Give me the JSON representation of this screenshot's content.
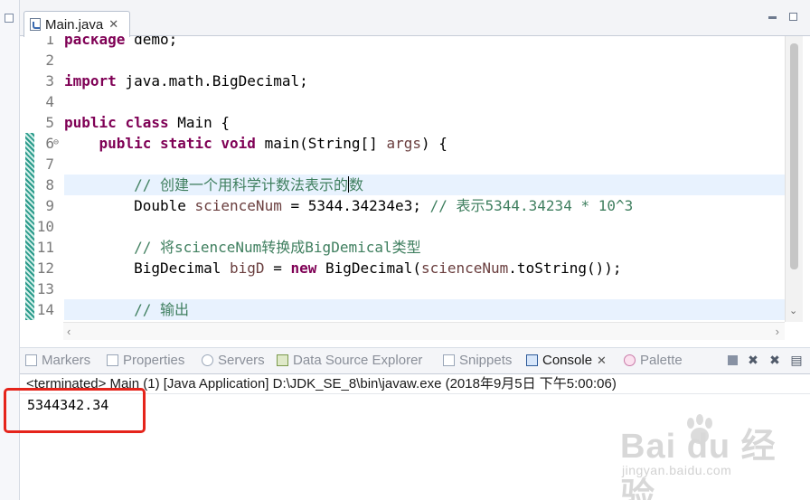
{
  "editor": {
    "tab_label": "Main.java",
    "lines": [
      {
        "n": "1",
        "segs": [
          {
            "c": "kw",
            "t": "package"
          },
          {
            "c": "",
            "t": " demo;"
          }
        ]
      },
      {
        "n": "2",
        "segs": []
      },
      {
        "n": "3",
        "segs": [
          {
            "c": "kw",
            "t": "import"
          },
          {
            "c": "",
            "t": " java.math.BigDecimal;"
          }
        ]
      },
      {
        "n": "4",
        "segs": []
      },
      {
        "n": "5",
        "segs": [
          {
            "c": "kw",
            "t": "public"
          },
          {
            "c": "",
            "t": " "
          },
          {
            "c": "kw",
            "t": "class"
          },
          {
            "c": "",
            "t": " Main {"
          }
        ]
      },
      {
        "n": "6",
        "segs": [
          {
            "c": "",
            "t": "    "
          },
          {
            "c": "kw",
            "t": "public"
          },
          {
            "c": "",
            "t": " "
          },
          {
            "c": "kw",
            "t": "static"
          },
          {
            "c": "",
            "t": " "
          },
          {
            "c": "kw",
            "t": "void"
          },
          {
            "c": "",
            "t": " main(String[] "
          },
          {
            "c": "vr",
            "t": "args"
          },
          {
            "c": "",
            "t": ") {"
          }
        ]
      },
      {
        "n": "7",
        "segs": []
      },
      {
        "n": "8",
        "segs": [
          {
            "c": "",
            "t": "        "
          },
          {
            "c": "cm",
            "t": "// 创建一个用科学计数法表示的"
          },
          {
            "c": "caret",
            "t": ""
          },
          {
            "c": "cm",
            "t": "数"
          }
        ]
      },
      {
        "n": "9",
        "segs": [
          {
            "c": "",
            "t": "        Double "
          },
          {
            "c": "vr",
            "t": "scienceNum"
          },
          {
            "c": "",
            "t": " = 5344.34234e3; "
          },
          {
            "c": "cm",
            "t": "// 表示5344.34234 * 10^3"
          }
        ]
      },
      {
        "n": "10",
        "segs": []
      },
      {
        "n": "11",
        "segs": [
          {
            "c": "",
            "t": "        "
          },
          {
            "c": "cm",
            "t": "// 将scienceNum转换成BigDemical类型"
          }
        ]
      },
      {
        "n": "12",
        "segs": [
          {
            "c": "",
            "t": "        BigDecimal "
          },
          {
            "c": "vr",
            "t": "bigD"
          },
          {
            "c": "",
            "t": " = "
          },
          {
            "c": "kw",
            "t": "new"
          },
          {
            "c": "",
            "t": " BigDecimal("
          },
          {
            "c": "vr",
            "t": "scienceNum"
          },
          {
            "c": "",
            "t": ".toString());"
          }
        ]
      },
      {
        "n": "13",
        "segs": []
      },
      {
        "n": "14",
        "segs": [
          {
            "c": "",
            "t": "        "
          },
          {
            "c": "cm",
            "t": "// 输出"
          }
        ]
      }
    ]
  },
  "views": {
    "tabs": [
      {
        "label": "Markers",
        "icon": "markers-icon",
        "active": false
      },
      {
        "label": "Properties",
        "icon": "properties-icon",
        "active": false
      },
      {
        "label": "Servers",
        "icon": "servers-icon",
        "active": false
      },
      {
        "label": "Data Source Explorer",
        "icon": "data-source-icon",
        "active": false
      },
      {
        "label": "Snippets",
        "icon": "snippets-icon",
        "active": false
      },
      {
        "label": "Console",
        "icon": "console-icon",
        "active": true
      },
      {
        "label": "Palette",
        "icon": "palette-icon",
        "active": false
      }
    ]
  },
  "console": {
    "header": "<terminated> Main (1) [Java Application] D:\\JDK_SE_8\\bin\\javaw.exe (2018年9月5日 下午5:00:06)",
    "output": "5344342.34"
  },
  "watermark": {
    "logo": "Bai  du 经验",
    "url": "jingyan.baidu.com"
  },
  "colors": {
    "keyword": "#7f0055",
    "comment": "#3f7f5f",
    "variable": "#6a3e3e",
    "highlight_box": "#e5241b"
  }
}
